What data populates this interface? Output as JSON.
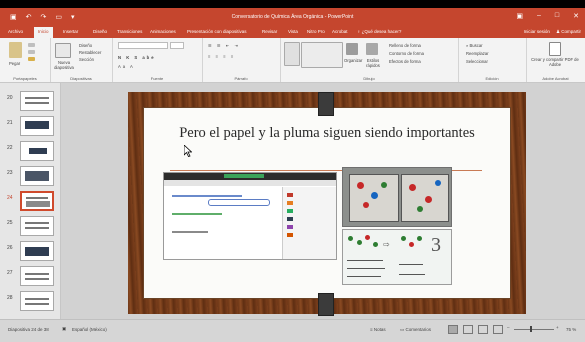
{
  "window": {
    "title": "Conversatorio de Química Área Orgánica - PowerPoint",
    "qat_icons": [
      "save-icon",
      "undo-icon",
      "redo-icon",
      "present-icon",
      "customize-icon"
    ]
  },
  "tabs": [
    "Archivo",
    "Inicio",
    "Insertar",
    "Diseño",
    "Transiciones",
    "Animaciones",
    "Presentación con diapositivas",
    "Revisar",
    "Vista",
    "Nitro Pro",
    "Acrobat"
  ],
  "tell_me": "¿Qué desea hacer?",
  "account": {
    "signin": "Iniciar sesión",
    "share": "Compartir"
  },
  "ribbon": {
    "clipboard": {
      "paste": "Pegar",
      "label": "Portapapeles"
    },
    "slides": {
      "new_slide": "Nueva diapositiva",
      "layout": "Diseño",
      "reset": "Restablecer",
      "section": "Sección",
      "label": "Diapositivas"
    },
    "font": {
      "label": "Fuente"
    },
    "paragraph": {
      "label": "Párrafo"
    },
    "drawing": {
      "arrange": "Organizar",
      "quick_styles": "Estilos rápidos",
      "fill": "Relleno de forma",
      "outline": "Contorno de forma",
      "effects": "Efectos de forma",
      "label": "Dibujo"
    },
    "editing": {
      "find": "Buscar",
      "replace": "Reemplazar",
      "select": "Seleccionar",
      "label": "Edición"
    },
    "adobe": {
      "create": "Crear y compartir PDF de Adobe",
      "label": "Adobe Acrobat"
    }
  },
  "thumbnails": [
    {
      "num": "20",
      "selected": false
    },
    {
      "num": "21",
      "selected": false
    },
    {
      "num": "22",
      "selected": false
    },
    {
      "num": "23",
      "selected": false
    },
    {
      "num": "24",
      "selected": true
    },
    {
      "num": "25",
      "selected": false
    },
    {
      "num": "26",
      "selected": false
    },
    {
      "num": "27",
      "selected": false
    },
    {
      "num": "28",
      "selected": false
    }
  ],
  "slide": {
    "title": "Pero el papel y la pluma siguen siendo importantes",
    "number_three": "3"
  },
  "status": {
    "slide_count": "Diapositiva 24 de 38",
    "language": "Español (México)",
    "notes": "Notas",
    "comments": "Comentarios",
    "zoom": "75 %"
  },
  "colors": {
    "accent": "#c5462e",
    "frame_wood": "#7c3f1c"
  }
}
